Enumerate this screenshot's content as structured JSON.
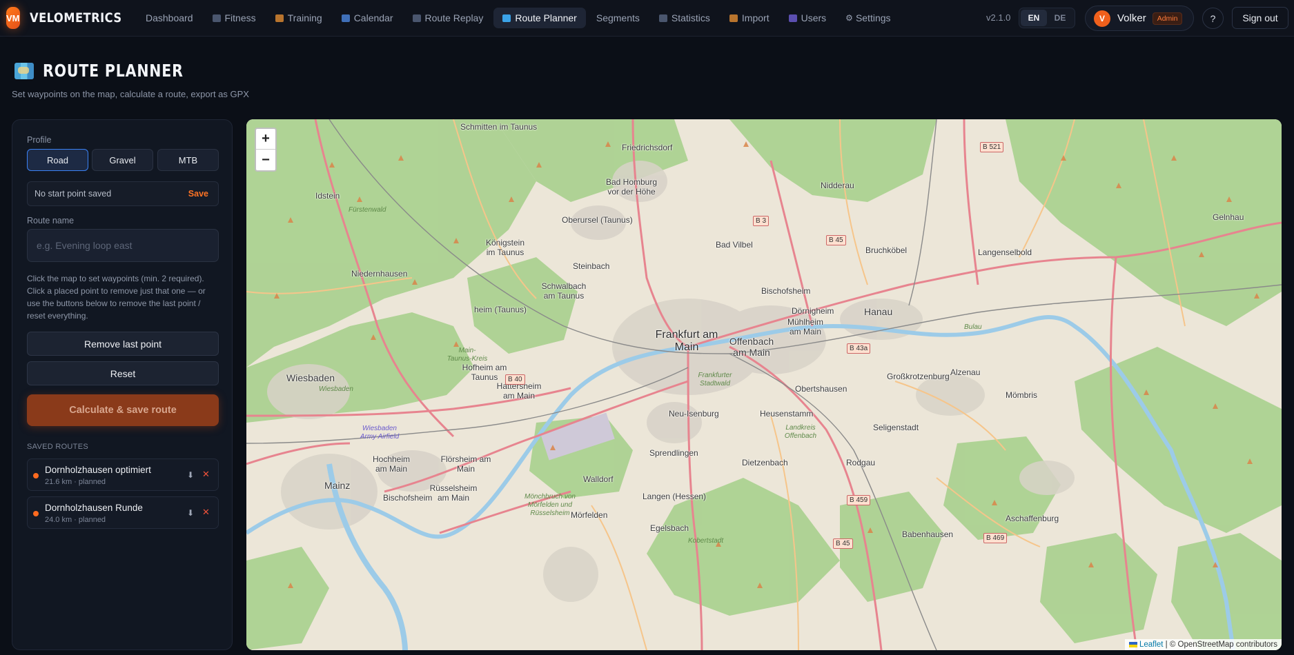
{
  "app": {
    "logo_text": "VM",
    "name": "VELOMETRICS",
    "version": "v2.1.0"
  },
  "nav": [
    {
      "label": "Dashboard",
      "icon": "none"
    },
    {
      "label": "Fitness",
      "icon": "chart-icon"
    },
    {
      "label": "Training",
      "icon": "muscle-icon"
    },
    {
      "label": "Calendar",
      "icon": "calendar-icon"
    },
    {
      "label": "Route Replay",
      "icon": "replay-icon"
    },
    {
      "label": "Route Planner",
      "icon": "map-icon",
      "active": true
    },
    {
      "label": "Segments",
      "icon": "none"
    },
    {
      "label": "Statistics",
      "icon": "bar-chart-icon"
    },
    {
      "label": "Import",
      "icon": "folder-icon"
    },
    {
      "label": "Users",
      "icon": "users-icon"
    },
    {
      "label": "Settings",
      "icon": "gear-icon"
    }
  ],
  "lang": {
    "en": "EN",
    "de": "DE",
    "active": "EN"
  },
  "user": {
    "initial": "V",
    "name": "Volker",
    "role": "Admin"
  },
  "help_label": "?",
  "signout_label": "Sign out",
  "page": {
    "title": "ROUTE PLANNER",
    "subtitle": "Set waypoints on the map, calculate a route, export as GPX"
  },
  "sidebar": {
    "profile_label": "Profile",
    "profiles": [
      "Road",
      "Gravel",
      "MTB"
    ],
    "selected_profile": "Road",
    "start_point_text": "No start point saved",
    "start_point_save": "Save",
    "route_name_label": "Route name",
    "route_name_placeholder": "e.g. Evening loop east",
    "route_name_value": "",
    "hint": "Click the map to set waypoints (min. 2 required). Click a placed point to remove just that one — or use the buttons below to remove the last point / reset everything.",
    "remove_last_label": "Remove last point",
    "reset_label": "Reset",
    "calculate_label": "Calculate & save route",
    "saved_routes_label": "SAVED ROUTES",
    "saved_routes": [
      {
        "name": "Dornholzhausen optimiert",
        "meta": "21.6 km · planned"
      },
      {
        "name": "Dornholzhausen Runde",
        "meta": "24.0 km · planned"
      }
    ],
    "download_glyph": "⬇",
    "delete_glyph": "✕"
  },
  "map": {
    "zoom_in": "+",
    "zoom_out": "−",
    "attribution_leaflet": "Leaflet",
    "attribution_rest": "| © OpenStreetMap contributors",
    "labels": {
      "frankfurt": "Frankfurt am Main",
      "offenbach": "Offenbach am Main",
      "wiesbaden": "Wiesbaden",
      "mainz": "Mainz",
      "hanau": "Hanau",
      "bad_homburg": "Bad Homburg vor der Höhe",
      "oberursel": "Oberursel (Taunus)",
      "friedrichsdorf": "Friedrichsdorf",
      "schmitten": "Schmitten im Taunus",
      "idstein": "Idstein",
      "nidderau": "Nidderau",
      "bad_vilbel": "Bad Vilbel",
      "bruchkobel": "Bruchköbel",
      "langenselbold": "Langenselbold",
      "koenigstein": "Königstein im Taunus",
      "steinbach": "Steinbach",
      "niedernhausen": "Niedernhausen",
      "schwalbach": "Schwalbach am Taunus",
      "kelkheim": "heim (Taunus)",
      "bischofsheim": "Bischofsheim",
      "doernigheim": "Dörnigheim",
      "muehlheim": "Mühlheim am Main",
      "hofheim": "Hofheim am Taunus",
      "hattersheim": "Hattersheim am Main",
      "neu_isenburg": "Neu-Isenburg",
      "heusenstamm": "Heusenstamm",
      "obertshausen": "Obertshausen",
      "grosskrotzenburg": "Großkrotzenburg",
      "alzenau": "Alzenau",
      "seligenstadt": "Seligenstadt",
      "hochheim": "Hochheim am Main",
      "floersheim": "Flörsheim am Main",
      "sprendlingen": "Sprendlingen",
      "dietzenbach": "Dietzenbach",
      "rodgau": "Rodgau",
      "walldorf": "Walldorf",
      "ruesselsheim": "Rüsselsheim am Main",
      "bischofsheim2": "Bischofsheim",
      "langen": "Langen (Hessen)",
      "moerfelden": "Mörfelden",
      "egelsbach": "Egelsbach",
      "babenhausen": "Babenhausen",
      "aschaffenburg": "Aschaffenburg",
      "mombris": "Mömbris",
      "gelnhausen": "Gelnhau",
      "wiesbaden_airfield": "Wiesbaden Army Airfield",
      "main_taunus": "Main-Taunus-Kreis",
      "stadtwald": "Frankfurter Stadtwald",
      "landkreis_offenbach": "Landkreis Offenbach",
      "monchbruch": "Mönchbruch von Mörfelden und Rüsselsheim",
      "bulau": "Bulau",
      "fuerstenwald": "Fürstenwald",
      "kobertstadt": "Kobertstadt",
      "wiesbaden_small": "Wiesbaden",
      "b521": "B 521",
      "b3": "B 3",
      "b45a": "B 45",
      "b43a": "B 43a",
      "b40": "B 40",
      "b459": "B 459",
      "b45b": "B 45",
      "b469": "B 469"
    }
  }
}
